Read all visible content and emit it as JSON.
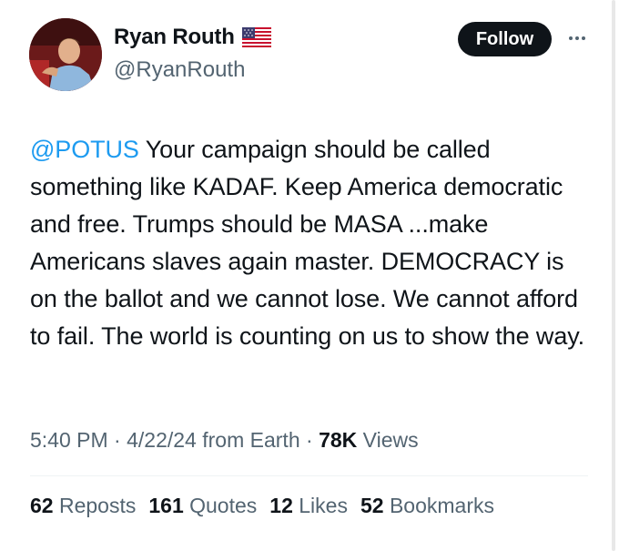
{
  "user": {
    "display_name": "Ryan Routh",
    "flag_icon": "us-flag-icon",
    "handle": "@RyanRouth"
  },
  "actions": {
    "follow_label": "Follow",
    "more_icon": "more-horizontal-icon"
  },
  "tweet": {
    "mention": "@POTUS",
    "text": " Your campaign should be called something like KADAF. Keep America democratic and free. Trumps should be MASA ...make Americans slaves again master. DEMOCRACY is on the ballot and we cannot lose. We cannot afford to fail. The world is counting on us to show the way."
  },
  "meta": {
    "time": "5:40 PM",
    "sep1": " · ",
    "date": "4/22/24",
    "source": " from Earth",
    "sep2": " · ",
    "views_count": "78K",
    "views_label": " Views"
  },
  "stats": [
    {
      "count": "62",
      "label": " Reposts"
    },
    {
      "count": "161",
      "label": " Quotes"
    },
    {
      "count": "12",
      "label": " Likes"
    },
    {
      "count": "52",
      "label": " Bookmarks"
    }
  ],
  "colors": {
    "link": "#1d9bf0",
    "text": "#0f1419",
    "secondary": "#536471",
    "button": "#0f1419"
  }
}
